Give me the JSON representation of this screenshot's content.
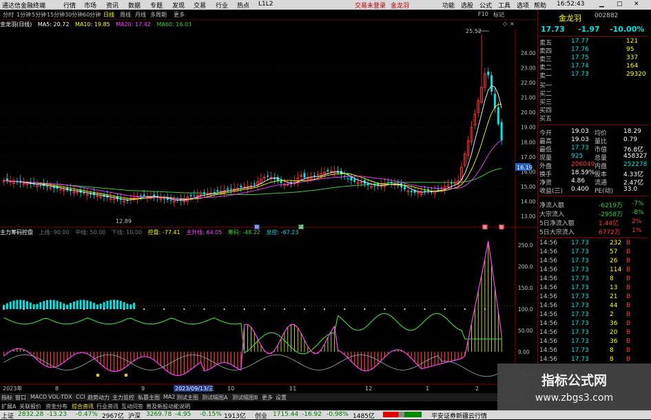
{
  "menubar": {
    "app_title": "通达信金融终端",
    "items": [
      "行情",
      "市场",
      "资讯",
      "数据",
      "专题",
      "发现",
      "交易",
      "行业",
      "热点",
      "L1L2"
    ],
    "center": [
      "交易未登录",
      "金龙羽"
    ],
    "right": [
      "功能",
      "选股",
      "公式",
      "工具",
      "选项",
      "帮助"
    ],
    "time": "16:52:43"
  },
  "periodbar": {
    "items": [
      "分时",
      "1分钟",
      "5分钟",
      "15分钟",
      "30分钟",
      "60分钟",
      "日线",
      "周线",
      "月线",
      "多周期",
      "更多"
    ],
    "active": "日线",
    "right": [
      "F10",
      "标记"
    ]
  },
  "ma_line": {
    "title": "金龙羽(日线)",
    "ma5": "MA5: 20.72",
    "ma10": "MA10: 19.85",
    "ma20": "MA20: 17.42",
    "ma60": "MA60: 16.03"
  },
  "price_axis": [
    "24.00",
    "23.00",
    "22.00",
    "21.00",
    "20.00",
    "19.00",
    "18.00",
    "17.00",
    "16.00",
    "15.00",
    "14.00",
    "13.00"
  ],
  "price_labels": {
    "high": "25.52",
    "low": "12.89",
    "current": "16.19"
  },
  "price_markers": [
    "财",
    "减",
    "盈",
    "盈"
  ],
  "indicator": {
    "title": "主力筹码控盘",
    "fields": [
      "上线: 90.00",
      "中线: 50.00",
      "下线: 10.00",
      "控盘: -77.41",
      "主升线: 64.05",
      "筹码: -48.22",
      "总控: -67.23"
    ],
    "axis": [
      "250.0",
      "200.0",
      "150.0",
      "100.0",
      "50.00",
      "0.00",
      "-50.00"
    ]
  },
  "date_axis": [
    "2023年",
    "8",
    "9",
    "2023/09/13/三",
    "10",
    "11",
    "12",
    "1",
    "2"
  ],
  "bottom_tabs": [
    "指标",
    "窗口",
    "MACD",
    "VOL-TDX",
    "CCI",
    "趋势动力",
    "主力监控",
    "私募主图",
    "MA2",
    "测试主图",
    "测试幅图A",
    "测试幅图B",
    "更多",
    "设置"
  ],
  "bottom_tabs2": [
    "扩展A",
    "关联报价",
    "资金分布",
    "综合资讯",
    "行业资讯",
    "互动问答",
    "普及新股动能说明"
  ],
  "quote": {
    "name": "金龙羽",
    "code": "002882",
    "price": "17.73",
    "change": "-1.97",
    "pct": "-10.00%",
    "asks": [
      {
        "label": "卖五",
        "price": "17.77",
        "vol": "121"
      },
      {
        "label": "卖四",
        "price": "17.76",
        "vol": "95"
      },
      {
        "label": "卖三",
        "price": "17.75",
        "vol": "337"
      },
      {
        "label": "卖二",
        "price": "17.74",
        "vol": "164"
      },
      {
        "label": "卖一",
        "price": "17.73",
        "vol": "29320"
      }
    ],
    "bids": [
      "买一",
      "买二",
      "买三",
      "买四",
      "买五"
    ],
    "stats": [
      {
        "l1": "今开",
        "v1": "19.03",
        "l2": "均价",
        "v2": "18.29"
      },
      {
        "l1": "最高",
        "v1": "19.03",
        "l2": "量比",
        "v2": "0.79"
      },
      {
        "l1": "最低",
        "v1": "17.73",
        "l2": "市值",
        "v2": "76.8亿"
      },
      {
        "l1": "现量",
        "v1": "925",
        "l2": "总量",
        "v2": "458327"
      },
      {
        "l1": "外盘",
        "v1": "206049",
        "l2": "内盘",
        "v2": "252278"
      },
      {
        "l1": "换手",
        "v1": "18.59%",
        "l2": "股本",
        "v2": "4.33亿"
      },
      {
        "l1": "净资",
        "v1": "4.86",
        "l2": "流通",
        "v2": "2.47亿"
      },
      {
        "l1": "收益(三)",
        "v1": "0.400",
        "l2": "PE(动)",
        "v2": "33.0"
      }
    ],
    "flows": [
      {
        "label": "净流入额",
        "value": "-6219万",
        "pct": "-7%"
      },
      {
        "label": "大宗流入",
        "value": "-2958万",
        "pct": "-8%"
      },
      {
        "label": "5日净流入额",
        "value": "1.44亿",
        "pct": "2%"
      },
      {
        "label": "5日大宗流入",
        "value": "6772万",
        "pct": "1%"
      }
    ],
    "ticks": [
      {
        "t": "14:56",
        "p": "17.73",
        "v": "232",
        "s": "B"
      },
      {
        "t": "14:56",
        "p": "17.73",
        "v": "57",
        "s": "B"
      },
      {
        "t": "14:56",
        "p": "17.73",
        "v": "26",
        "s": "B"
      },
      {
        "t": "14:56",
        "p": "17.73",
        "v": "114",
        "s": "B"
      },
      {
        "t": "14:56",
        "p": "17.73",
        "v": "8",
        "s": "B"
      },
      {
        "t": "14:56",
        "p": "17.73",
        "v": "13",
        "s": "B"
      },
      {
        "t": "14:56",
        "p": "17.73",
        "v": "21",
        "s": "B"
      },
      {
        "t": "14:56",
        "p": "17.73",
        "v": "44",
        "s": "B"
      },
      {
        "t": "14:56",
        "p": "17.73",
        "v": "2",
        "s": "B"
      },
      {
        "t": "14:56",
        "p": "17.73",
        "v": "36",
        "s": "B"
      },
      {
        "t": "14:56",
        "p": "17.73",
        "v": "20",
        "s": "B"
      },
      {
        "t": "14:56",
        "p": "17.73",
        "v": "36",
        "s": "B"
      },
      {
        "t": "14:56",
        "p": "17.73",
        "v": "8",
        "s": "B"
      },
      {
        "t": "14:56",
        "p": "17.73",
        "v": "8",
        "s": "B"
      }
    ]
  },
  "statusbar": {
    "items": [
      {
        "label": "上证",
        "value": "2832.28",
        "chg": "-13.23",
        "pct": "-0.47%",
        "amt": "2967亿"
      },
      {
        "label": "沪深",
        "value": "3269.78",
        "chg": "-4.95",
        "pct": "-0.15%",
        "amt": "1913亿"
      },
      {
        "label": "创业",
        "value": "1715.44",
        "chg": "-16.92",
        "pct": "-0.98%",
        "amt": "1485亿"
      }
    ],
    "right_text": "平安证券新疆云行情"
  },
  "watermark": {
    "line1": "指标公式网",
    "line2": "www.zbgs3.com"
  },
  "colors": {
    "up": "#ff3b3b",
    "down": "#00e5e5",
    "yellow": "#ffff00",
    "green": "#39d13a",
    "magenta": "#ff40ff",
    "white": "#ffffff",
    "accent_red": "#8b0000"
  }
}
